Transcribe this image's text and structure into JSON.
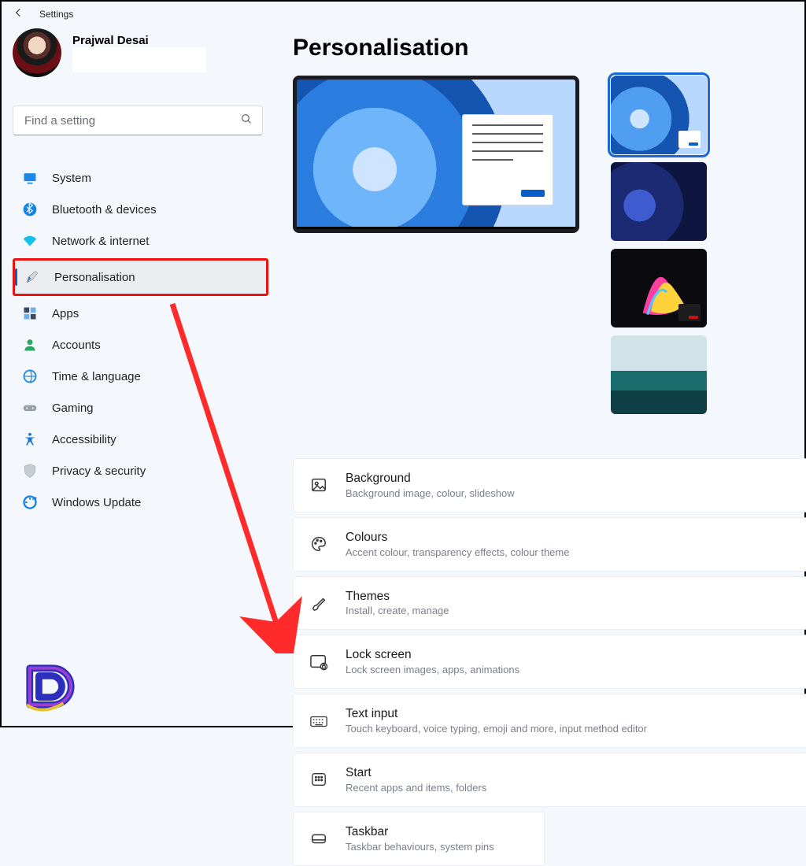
{
  "window": {
    "title": "Settings"
  },
  "user": {
    "name": "Prajwal Desai"
  },
  "search": {
    "placeholder": "Find a setting"
  },
  "nav": {
    "items": [
      {
        "label": "System"
      },
      {
        "label": "Bluetooth & devices"
      },
      {
        "label": "Network & internet"
      },
      {
        "label": "Personalisation"
      },
      {
        "label": "Apps"
      },
      {
        "label": "Accounts"
      },
      {
        "label": "Time & language"
      },
      {
        "label": "Gaming"
      },
      {
        "label": "Accessibility"
      },
      {
        "label": "Privacy & security"
      },
      {
        "label": "Windows Update"
      }
    ],
    "selected_index": 3
  },
  "page": {
    "title": "Personalisation"
  },
  "settings": [
    {
      "title": "Background",
      "subtitle": "Background image, colour, slideshow"
    },
    {
      "title": "Colours",
      "subtitle": "Accent colour, transparency effects, colour theme"
    },
    {
      "title": "Themes",
      "subtitle": "Install, create, manage"
    },
    {
      "title": "Lock screen",
      "subtitle": "Lock screen images, apps, animations"
    },
    {
      "title": "Text input",
      "subtitle": "Touch keyboard, voice typing, emoji and more, input method editor"
    },
    {
      "title": "Start",
      "subtitle": "Recent apps and items, folders"
    },
    {
      "title": "Taskbar",
      "subtitle": "Taskbar behaviours, system pins"
    }
  ],
  "annotation": {
    "highlighted_setting_index": 6
  }
}
